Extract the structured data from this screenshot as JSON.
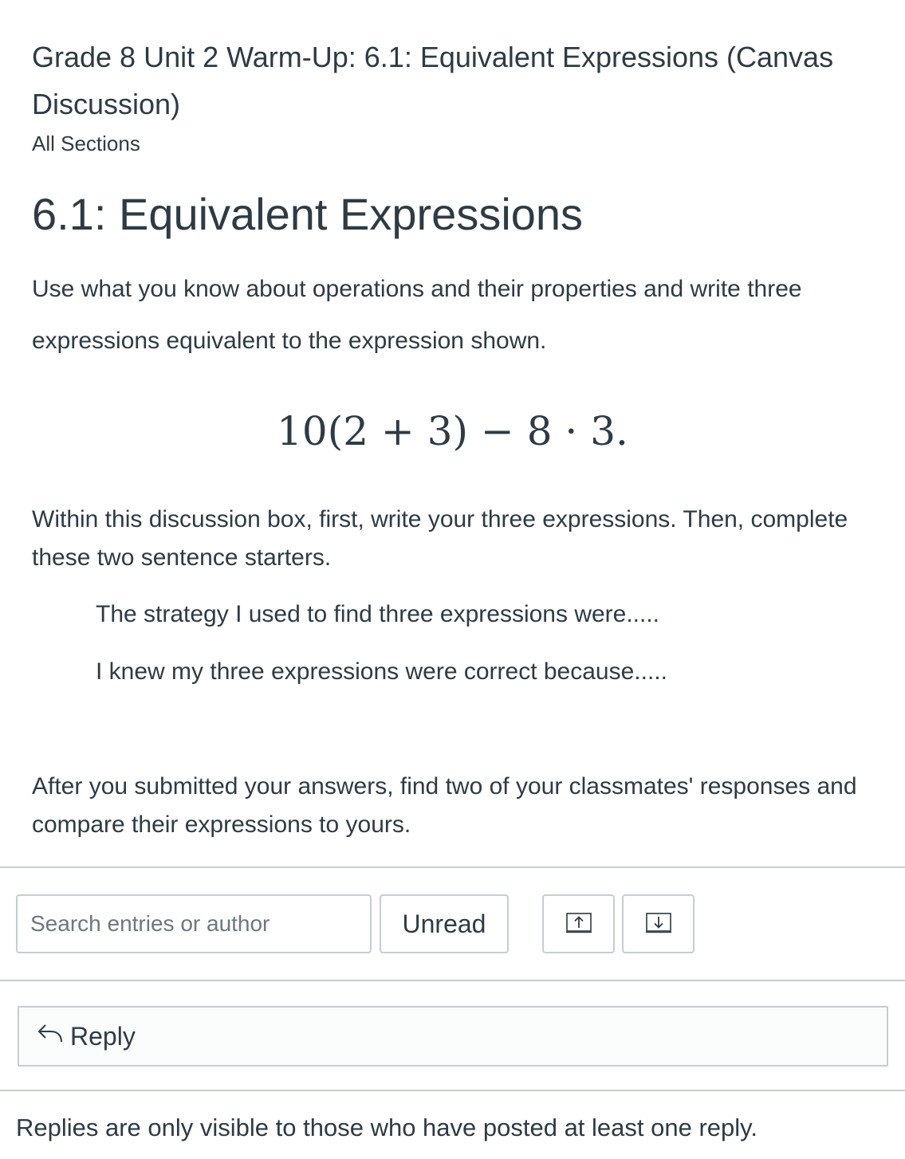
{
  "header": {
    "title": "Grade 8 Unit 2 Warm-Up: 6.1: Equivalent Expressions (Canvas Discussion)",
    "sections": "All Sections"
  },
  "content": {
    "heading": "6.1: Equivalent Expressions",
    "intro": "Use what you know about operations and their properties and write three expressions equivalent to the expression shown.",
    "expression": "10(2 + 3) − 8 · 3.",
    "instructions": "Within this discussion box, first, write your three expressions. Then, complete these two sentence starters.",
    "starter_1": "The strategy I used to find three expressions were.....",
    "starter_2": "I knew my three expressions were correct because.....",
    "followup": "After you submitted your answers,  find two of your classmates' responses and compare their expressions to yours."
  },
  "toolbar": {
    "search_placeholder": "Search entries or author",
    "unread_label": "Unread",
    "expand_icon": "expand-arrow-up-icon",
    "collapse_icon": "collapse-arrow-down-icon"
  },
  "reply": {
    "label": "Reply",
    "icon": "reply-arrow-icon"
  },
  "footer": {
    "notice": "Replies are only visible to those who have posted at least one reply."
  },
  "colors": {
    "text": "#2d3b45",
    "border": "#c7cdd1",
    "placeholder": "#6b7780"
  }
}
